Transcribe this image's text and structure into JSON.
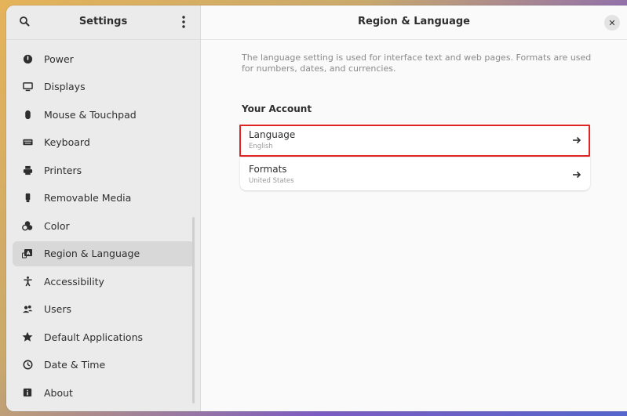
{
  "sidebar": {
    "title": "Settings",
    "items": [
      {
        "label": "Power",
        "icon": "power-icon"
      },
      {
        "label": "Displays",
        "icon": "display-icon"
      },
      {
        "label": "Mouse & Touchpad",
        "icon": "mouse-icon"
      },
      {
        "label": "Keyboard",
        "icon": "keyboard-icon"
      },
      {
        "label": "Printers",
        "icon": "printer-icon"
      },
      {
        "label": "Removable Media",
        "icon": "usb-icon"
      },
      {
        "label": "Color",
        "icon": "color-icon"
      },
      {
        "label": "Region & Language",
        "icon": "region-language-icon",
        "active": true
      },
      {
        "label": "Accessibility",
        "icon": "accessibility-icon"
      },
      {
        "label": "Users",
        "icon": "users-icon"
      },
      {
        "label": "Default Applications",
        "icon": "star-icon"
      },
      {
        "label": "Date & Time",
        "icon": "clock-icon"
      },
      {
        "label": "About",
        "icon": "info-icon"
      }
    ]
  },
  "main": {
    "title": "Region & Language",
    "description": "The language setting is used for interface text and web pages. Formats are used for numbers, dates, and currencies.",
    "section_title": "Your Account",
    "rows": [
      {
        "title": "Language",
        "subtitle": "English"
      },
      {
        "title": "Formats",
        "subtitle": "United States"
      }
    ]
  },
  "colors": {
    "accent_highlight": "#e02424",
    "sidebar_bg": "#ebebeb",
    "main_bg": "#fafafa"
  }
}
